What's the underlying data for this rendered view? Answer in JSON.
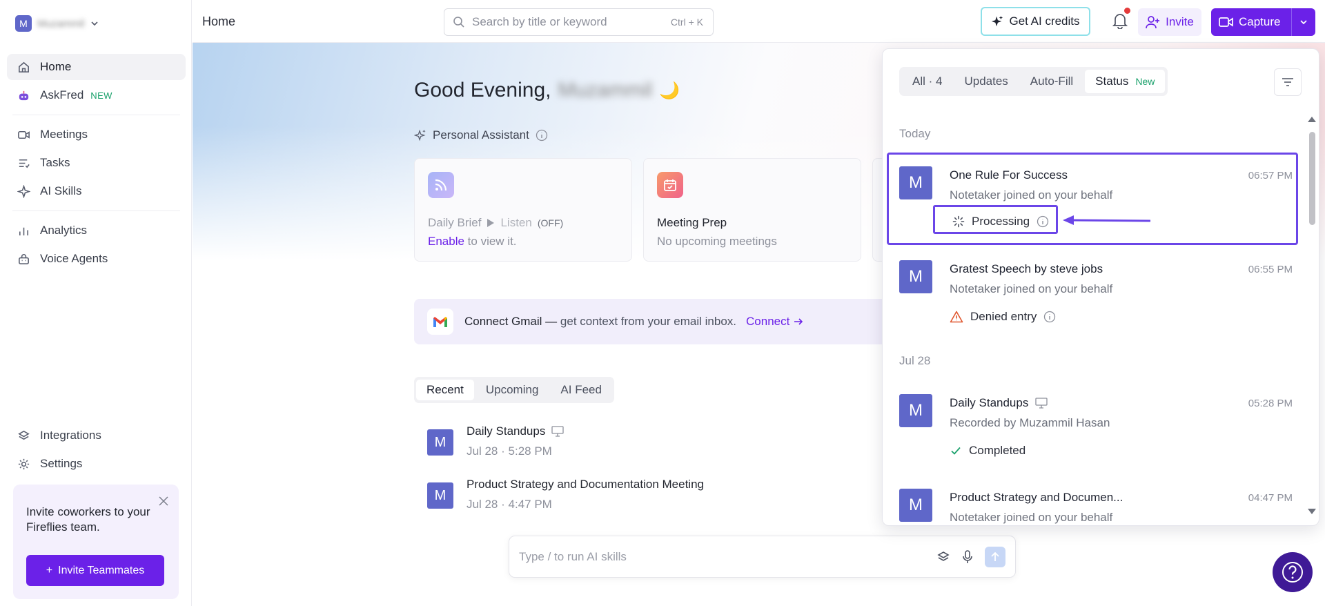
{
  "workspace": {
    "avatar_letter": "M",
    "name": "Muzammil"
  },
  "sidebar": {
    "items": [
      {
        "label": "Home",
        "icon": "home-icon",
        "active": true
      },
      {
        "label": "AskFred",
        "icon": "fred-bot-icon",
        "badge": "NEW"
      },
      {
        "label": "Meetings",
        "icon": "video-icon"
      },
      {
        "label": "Tasks",
        "icon": "tasks-icon"
      },
      {
        "label": "AI Skills",
        "icon": "sparkle-icon"
      },
      {
        "label": "Analytics",
        "icon": "analytics-icon"
      },
      {
        "label": "Voice Agents",
        "icon": "voice-agents-icon"
      },
      {
        "label": "Integrations",
        "icon": "layers-icon"
      },
      {
        "label": "Settings",
        "icon": "gear-icon"
      }
    ],
    "invite_card": {
      "text": "Invite coworkers to your Fireflies team.",
      "button_label": "Invite Teammates",
      "button_plus": "+"
    }
  },
  "topbar": {
    "breadcrumb": "Home",
    "search": {
      "placeholder": "Search by title or keyword",
      "shortcut": "Ctrl + K"
    },
    "credits_label": "Get AI credits",
    "invite_label": "Invite",
    "capture_label": "Capture"
  },
  "main": {
    "greeting": "Good Evening,",
    "greeting_name": "Muzammil",
    "greeting_emoji": "🌙",
    "assistant_label": "Personal Assistant",
    "cards": [
      {
        "title": "Daily Brief",
        "listen": "Listen",
        "listen_state": "(OFF)",
        "link": "Enable",
        "sub": "to view it."
      },
      {
        "title": "Meeting Prep",
        "sub": "No upcoming meetings"
      }
    ],
    "gmail": {
      "title": "Connect Gmail —",
      "text": "get context from your email inbox.",
      "link": "Connect"
    },
    "tabs": [
      "Recent",
      "Upcoming",
      "AI Feed"
    ],
    "meetings": [
      {
        "avatar": "M",
        "title": "Daily Standups",
        "date": "Jul 28",
        "time": "5:28 PM"
      },
      {
        "avatar": "M",
        "title": "Product Strategy and Documentation Meeting",
        "date": "Jul 28",
        "time": "4:47 PM"
      }
    ],
    "ai_input_placeholder": "Type / to run AI skills",
    "date_sep": "·"
  },
  "panel": {
    "tabs": [
      {
        "label": "All · 4"
      },
      {
        "label": "Updates"
      },
      {
        "label": "Auto-Fill"
      },
      {
        "label": "Status",
        "badge": "New",
        "selected": true
      }
    ],
    "groups": [
      {
        "day": "Today"
      },
      {
        "day": "Jul 28"
      }
    ],
    "items": [
      {
        "avatar": "M",
        "title": "One Rule For Success",
        "time": "06:57 PM",
        "sub": "Notetaker joined on your behalf",
        "status": "Processing"
      },
      {
        "avatar": "M",
        "title": "Gratest Speech by steve jobs",
        "time": "06:55 PM",
        "sub": "Notetaker joined on your behalf",
        "status": "Denied entry"
      },
      {
        "avatar": "M",
        "title": "Daily Standups",
        "time": "05:28 PM",
        "sub": "Recorded by Muzammil Hasan",
        "status": "Completed"
      },
      {
        "avatar": "M",
        "title": "Product Strategy and Documen...",
        "time": "04:47 PM",
        "sub": "Notetaker joined on your behalf"
      }
    ]
  },
  "colors": {
    "accent": "#6b21e8",
    "avatar": "#5f67c9",
    "new_badge": "#18a06a",
    "highlight": "#6b46e8"
  }
}
